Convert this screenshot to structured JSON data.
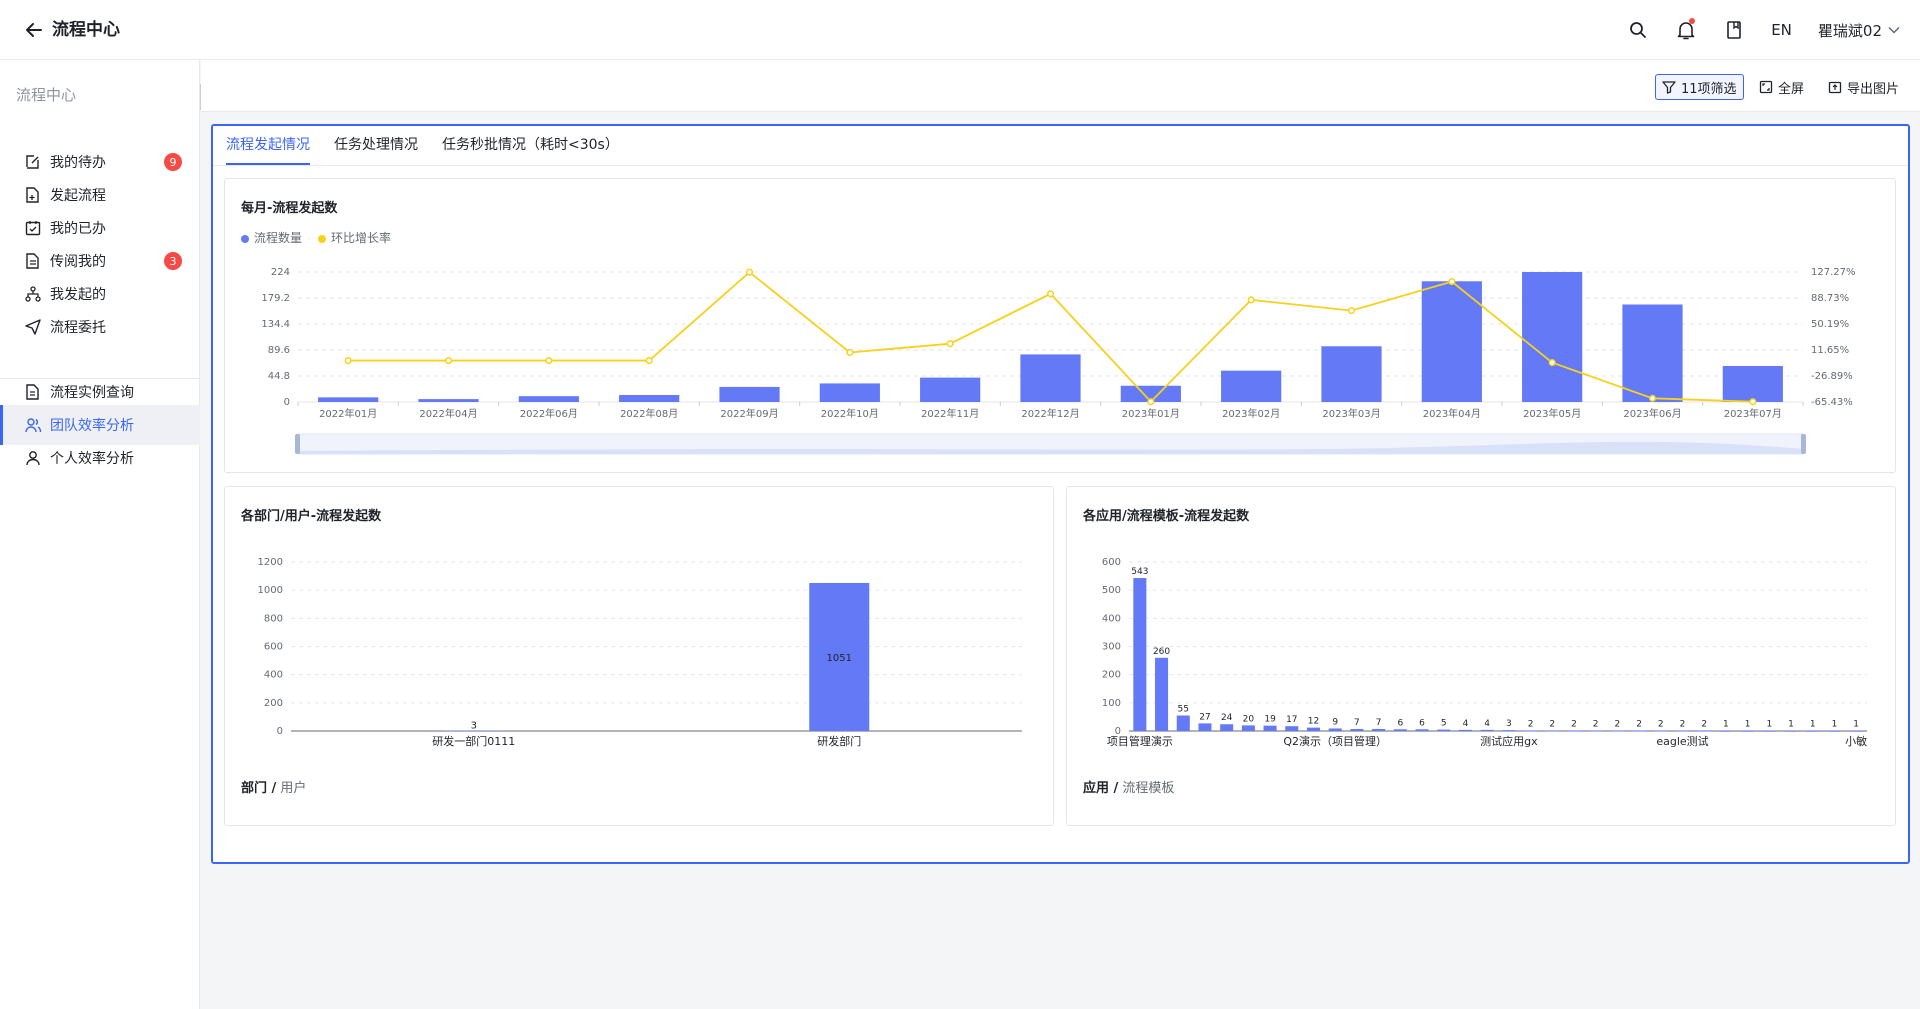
{
  "header": {
    "title": "流程中心",
    "lang": "EN",
    "user": "瞿瑞斌02"
  },
  "sidebar": {
    "heading": "流程中心",
    "items": [
      {
        "label": "我的待办",
        "icon": "edit-icon",
        "badge": "9"
      },
      {
        "label": "发起流程",
        "icon": "doc-add-icon",
        "badge": ""
      },
      {
        "label": "我的已办",
        "icon": "calendar-check-icon",
        "badge": ""
      },
      {
        "label": "传阅我的",
        "icon": "doc-icon",
        "badge": "3"
      },
      {
        "label": "我发起的",
        "icon": "flow-icon",
        "badge": ""
      },
      {
        "label": "流程委托",
        "icon": "send-icon",
        "badge": ""
      },
      {
        "label": "流程实例查询",
        "icon": "doc-search-icon",
        "badge": ""
      },
      {
        "label": "团队效率分析",
        "icon": "team-icon",
        "badge": ""
      },
      {
        "label": "个人效率分析",
        "icon": "person-icon",
        "badge": ""
      }
    ],
    "active_index": 7
  },
  "toolbar": {
    "filter": "11项筛选",
    "fullscreen": "全屏",
    "export": "导出图片"
  },
  "tabs": [
    {
      "label": "流程发起情况"
    },
    {
      "label": "任务处理情况"
    },
    {
      "label": "任务秒批情况（耗时<30s）"
    }
  ],
  "colors": {
    "bar": "#6379f5",
    "line": "#f7d11b",
    "accent": "#3b66f5"
  },
  "chart_data": [
    {
      "type": "bar",
      "title": "每月-流程发起数",
      "legend": [
        "流程数量",
        "环比增长率"
      ],
      "categories": [
        "2022年01月",
        "2022年04月",
        "2022年06月",
        "2022年08月",
        "2022年09月",
        "2022年10月",
        "2022年11月",
        "2022年12月",
        "2023年01月",
        "2023年02月",
        "2023年03月",
        "2023年04月",
        "2023年05月",
        "2023年06月",
        "2023年07月"
      ],
      "series": [
        {
          "name": "流程数量",
          "type": "bar",
          "axis": "left",
          "values": [
            8,
            5,
            10,
            12,
            26,
            32,
            42,
            82,
            28,
            54,
            96,
            208,
            224,
            168,
            62
          ]
        },
        {
          "name": "环比增长率",
          "type": "line",
          "axis": "right",
          "values": [
            -4,
            -4,
            -4,
            -4,
            127,
            8,
            21,
            95,
            -65,
            86,
            70,
            113,
            -7,
            -60,
            -65
          ]
        }
      ],
      "yticks_left": [
        "0",
        "44.8",
        "89.6",
        "134.4",
        "179.2",
        "224"
      ],
      "yticks_right": [
        "-65.43%",
        "-26.89%",
        "11.65%",
        "50.19%",
        "88.73%",
        "127.27%"
      ],
      "ylim_left": [
        0,
        224
      ],
      "ylim_right": [
        -65.43,
        127.27
      ]
    },
    {
      "type": "bar",
      "title": "各部门/用户-流程发起数",
      "categories": [
        "研发一部门0111",
        "研发部门"
      ],
      "values": [
        3,
        1051
      ],
      "value_labels": [
        "3",
        "1051"
      ],
      "yticks": [
        "0",
        "200",
        "400",
        "600",
        "800",
        "1000",
        "1200"
      ],
      "ylim": [
        0,
        1200
      ],
      "footer_bold": "部门 /",
      "footer_rest": " 用户"
    },
    {
      "type": "bar",
      "title": "各应用/流程模板-流程发起数",
      "values": [
        543,
        260,
        55,
        27,
        24,
        20,
        19,
        17,
        12,
        9,
        7,
        7,
        6,
        6,
        5,
        4,
        4,
        3,
        2,
        2,
        2,
        2,
        2,
        2,
        2,
        2,
        2,
        1,
        1,
        1,
        1,
        1,
        1,
        1
      ],
      "x_tick_labels": [
        {
          "index": 0,
          "label": "项目管理演示"
        },
        {
          "index": 9,
          "label": "Q2演示（项目管理）"
        },
        {
          "index": 17,
          "label": "测试应用gx"
        },
        {
          "index": 25,
          "label": "eagle测试"
        },
        {
          "index": 33,
          "label": "小敏"
        }
      ],
      "yticks": [
        "0",
        "100",
        "200",
        "300",
        "400",
        "500",
        "600"
      ],
      "ylim": [
        0,
        600
      ],
      "footer_bold": "应用 /",
      "footer_rest": " 流程模板"
    }
  ]
}
